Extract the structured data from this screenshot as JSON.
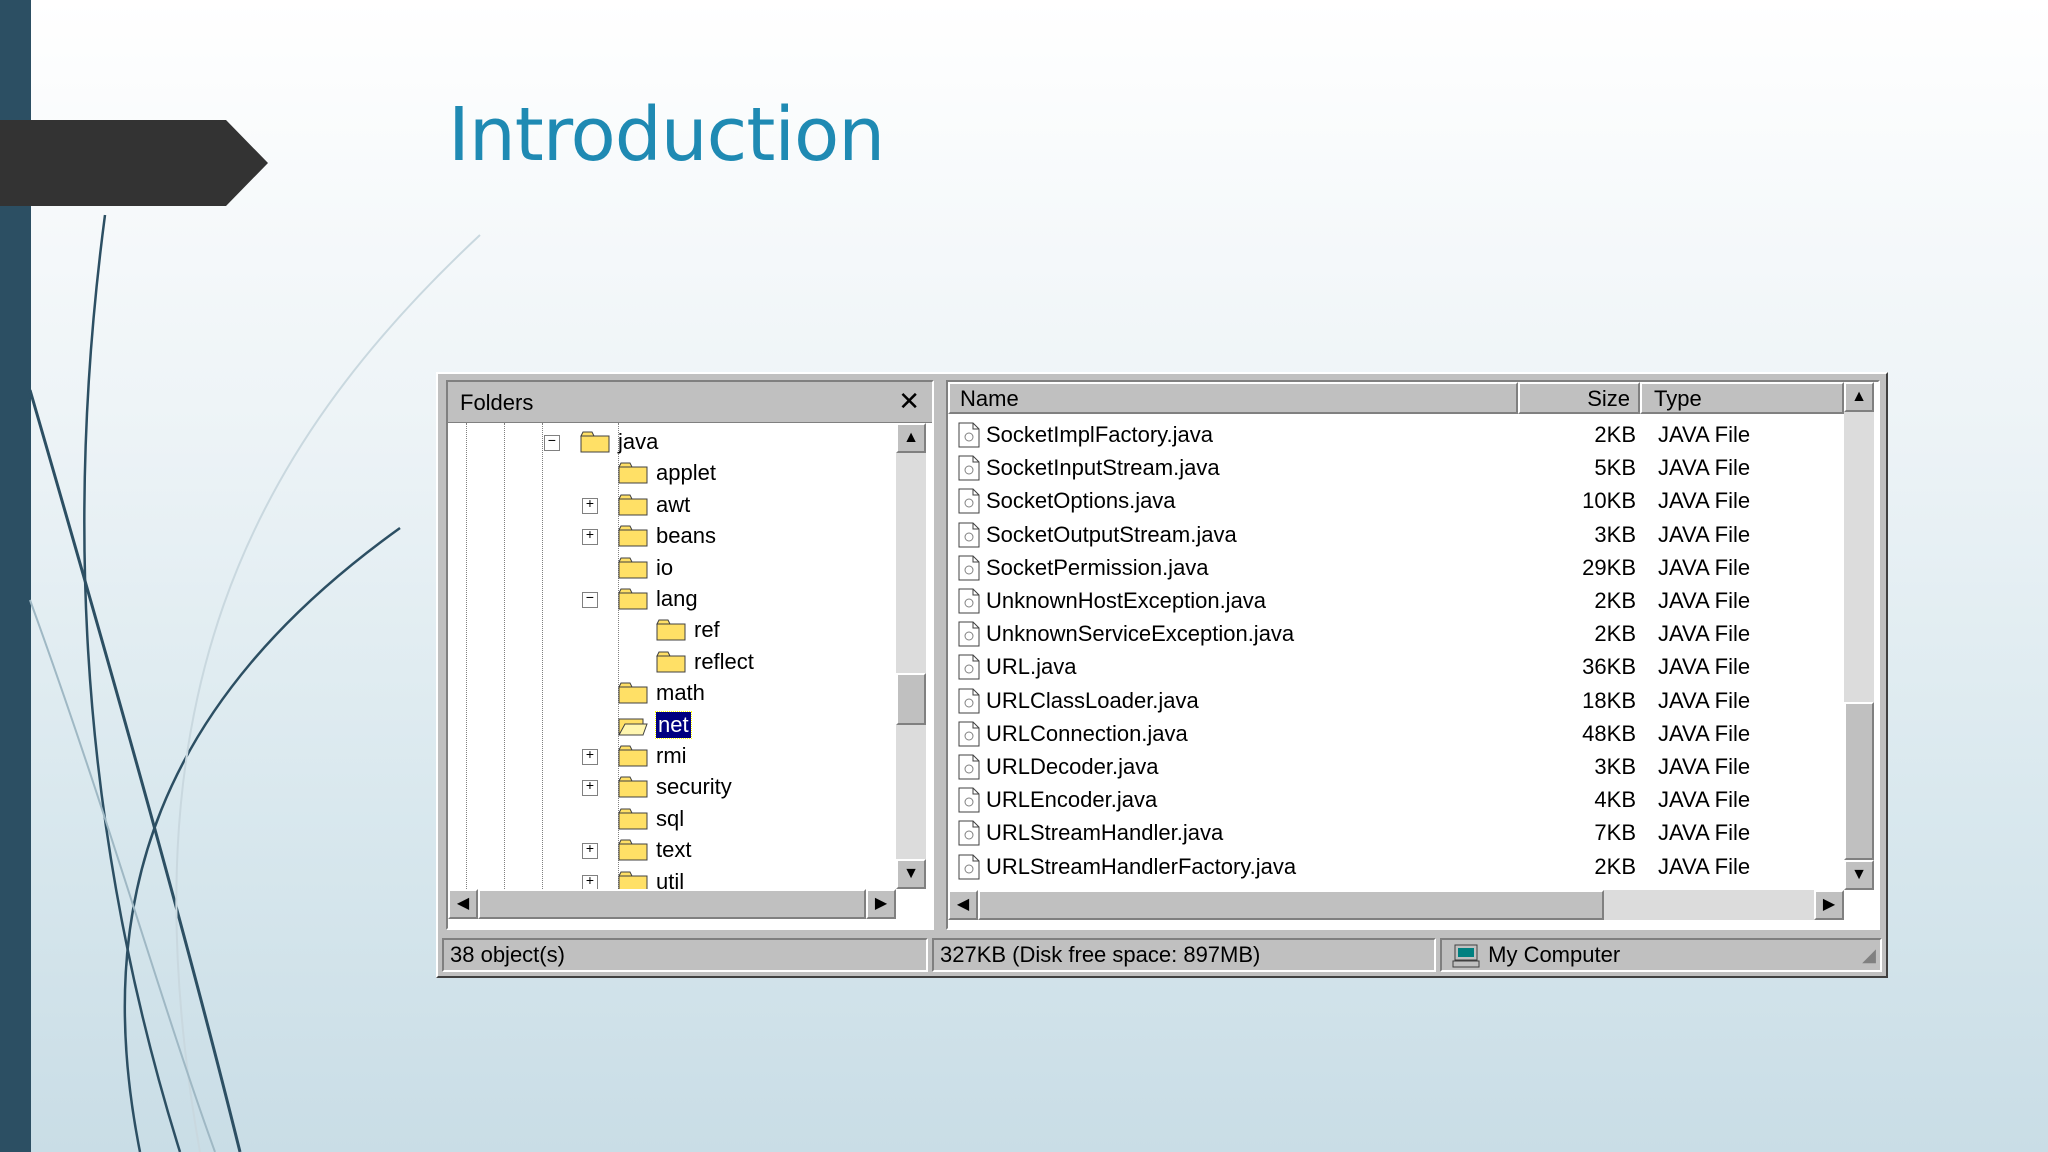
{
  "slide": {
    "title": "Introduction"
  },
  "colors": {
    "accent": "#1f8ab3",
    "sidebar": "#2c4f63",
    "arrow": "#333333",
    "selection": "#000080"
  },
  "folders_pane": {
    "header": "Folders",
    "close_icon": "close-icon",
    "tree": [
      {
        "label": "java",
        "level": 0,
        "expander": "minus"
      },
      {
        "label": "applet",
        "level": 1,
        "expander": "none"
      },
      {
        "label": "awt",
        "level": 1,
        "expander": "plus"
      },
      {
        "label": "beans",
        "level": 1,
        "expander": "plus"
      },
      {
        "label": "io",
        "level": 1,
        "expander": "none"
      },
      {
        "label": "lang",
        "level": 1,
        "expander": "minus"
      },
      {
        "label": "ref",
        "level": 2,
        "expander": "none"
      },
      {
        "label": "reflect",
        "level": 2,
        "expander": "none"
      },
      {
        "label": "math",
        "level": 1,
        "expander": "none"
      },
      {
        "label": "net",
        "level": 1,
        "expander": "none",
        "selected": true
      },
      {
        "label": "rmi",
        "level": 1,
        "expander": "plus"
      },
      {
        "label": "security",
        "level": 1,
        "expander": "plus"
      },
      {
        "label": "sql",
        "level": 1,
        "expander": "none"
      },
      {
        "label": "text",
        "level": 1,
        "expander": "plus"
      },
      {
        "label": "util",
        "level": 1,
        "expander": "plus"
      }
    ]
  },
  "file_list": {
    "columns": {
      "name": "Name",
      "size": "Size",
      "type": "Type"
    },
    "rows": [
      {
        "name": "SocketImplFactory.java",
        "size": "2KB",
        "type": "JAVA File"
      },
      {
        "name": "SocketInputStream.java",
        "size": "5KB",
        "type": "JAVA File"
      },
      {
        "name": "SocketOptions.java",
        "size": "10KB",
        "type": "JAVA File"
      },
      {
        "name": "SocketOutputStream.java",
        "size": "3KB",
        "type": "JAVA File"
      },
      {
        "name": "SocketPermission.java",
        "size": "29KB",
        "type": "JAVA File"
      },
      {
        "name": "UnknownHostException.java",
        "size": "2KB",
        "type": "JAVA File"
      },
      {
        "name": "UnknownServiceException.java",
        "size": "2KB",
        "type": "JAVA File"
      },
      {
        "name": "URL.java",
        "size": "36KB",
        "type": "JAVA File"
      },
      {
        "name": "URLClassLoader.java",
        "size": "18KB",
        "type": "JAVA File"
      },
      {
        "name": "URLConnection.java",
        "size": "48KB",
        "type": "JAVA File"
      },
      {
        "name": "URLDecoder.java",
        "size": "3KB",
        "type": "JAVA File"
      },
      {
        "name": "URLEncoder.java",
        "size": "4KB",
        "type": "JAVA File"
      },
      {
        "name": "URLStreamHandler.java",
        "size": "7KB",
        "type": "JAVA File"
      },
      {
        "name": "URLStreamHandlerFactory.java",
        "size": "2KB",
        "type": "JAVA File"
      }
    ]
  },
  "status_bar": {
    "objects": "38 object(s)",
    "disk": "327KB (Disk free space: 897MB)",
    "location": "My Computer",
    "location_icon": "computer-icon"
  }
}
